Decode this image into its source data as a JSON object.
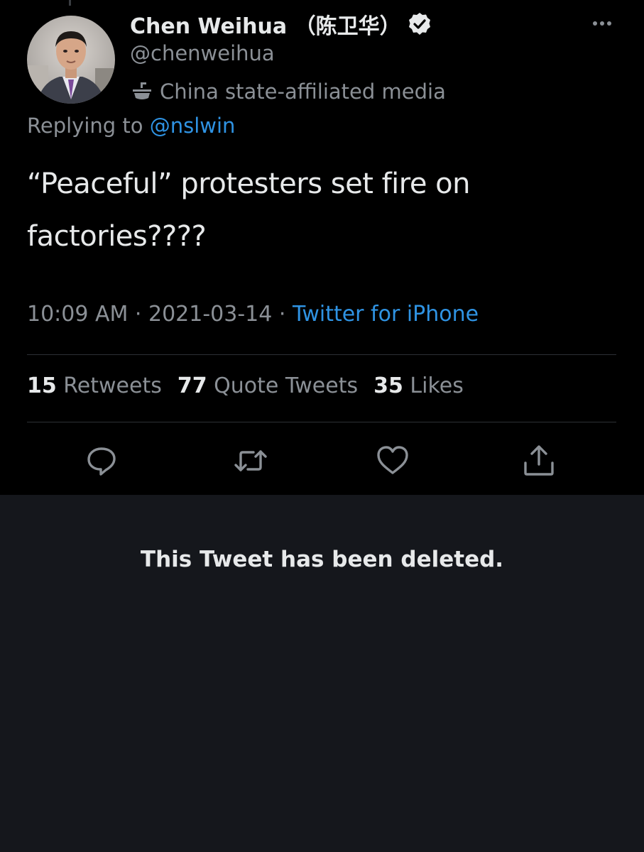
{
  "tweet": {
    "author_name": "Chen Weihua （陈卫华）",
    "handle": "@chenweihua",
    "label": "China state-affiliated media",
    "reply_prefix": "Replying to ",
    "reply_mention": "@nslwin",
    "text_line1": "“Peaceful” protesters set fire on",
    "text_line2": "factories????",
    "time": "10:09 AM · 2021-03-14 · ",
    "source": "Twitter for iPhone",
    "retweets_count": "15",
    "retweets_label": "Retweets",
    "quotes_count": "77",
    "quotes_label": "Quote Tweets",
    "likes_count": "35",
    "likes_label": "Likes"
  },
  "icons": {
    "verified": "verified-badge-icon",
    "more": "more-options-icon",
    "label": "government-media-icon",
    "reply": "reply-icon",
    "retweet": "retweet-icon",
    "like": "heart-icon",
    "share": "share-icon"
  },
  "colors": {
    "background": "#000000",
    "deleted_background": "#15171c",
    "link": "#2f93e3",
    "secondary_text": "#8b9096",
    "primary_text": "#e7e9ea"
  },
  "deleted_notice": "This Tweet has been deleted."
}
